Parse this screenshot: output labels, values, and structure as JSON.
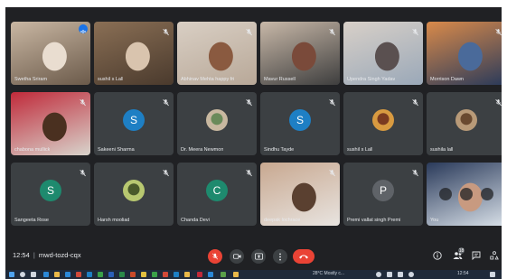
{
  "meeting": {
    "time": "12:54",
    "separator": "|",
    "code": "mwd-tozd-cqx"
  },
  "participants": [
    {
      "name": "Swetha Sriram",
      "type": "video",
      "colors": [
        "#6b5a4a",
        "#c9b7a3",
        "#e9ddd0"
      ]
    },
    {
      "name": "sushil s Lall",
      "type": "video",
      "colors": [
        "#4a3a2d",
        "#8a6f55",
        "#d9c4ae"
      ]
    },
    {
      "name": "Abhinav Mehta happy fri",
      "type": "video",
      "colors": [
        "#b8a898",
        "#d9cfc4",
        "#8a5a40"
      ]
    },
    {
      "name": "Mavur Russell",
      "type": "video",
      "colors": [
        "#3e3e3e",
        "#c8b8a8",
        "#7a4a3a"
      ]
    },
    {
      "name": "Upendra Singh Yadav",
      "type": "video",
      "colors": [
        "#9aa8b8",
        "#d8d0c8",
        "#5a5050"
      ]
    },
    {
      "name": "Morrison Dawn",
      "type": "video",
      "colors": [
        "#2a3a5a",
        "#d98a4a",
        "#4a6a9a"
      ]
    },
    {
      "name": "chabona mullick",
      "type": "video",
      "colors": [
        "#d8d4cc",
        "#c02a3a",
        "#4a3020"
      ]
    },
    {
      "name": "Sakeeni Sharma",
      "type": "initial",
      "initial": "S",
      "color": "#1e7fc4"
    },
    {
      "name": "Dr. Meera Newmon",
      "type": "photo",
      "colors": [
        "#c8b8a0",
        "#6a8a5a"
      ]
    },
    {
      "name": "Sindhu Tayde",
      "type": "initial",
      "initial": "S",
      "color": "#1e7fc4"
    },
    {
      "name": "sushil s Lall",
      "type": "photo",
      "colors": [
        "#d89a40",
        "#7a3a20"
      ]
    },
    {
      "name": "sushila lall",
      "type": "photo",
      "colors": [
        "#b89a78",
        "#6a4a30"
      ]
    },
    {
      "name": "Sangeeta Rose",
      "type": "initial",
      "initial": "S",
      "color": "#1e8a6e"
    },
    {
      "name": "Harsh mooliad",
      "type": "photo",
      "colors": [
        "#b8c870",
        "#4a5a2a"
      ]
    },
    {
      "name": "Chanda Devi",
      "type": "initial",
      "initial": "C",
      "color": "#1e8a6e"
    },
    {
      "name": "deepak lochrace",
      "type": "video",
      "colors": [
        "#e8e4e0",
        "#c8a890",
        "#5a4030"
      ]
    },
    {
      "name": "Premi vallat singh Premi",
      "type": "initial",
      "initial": "P",
      "color": "#5f6368"
    },
    {
      "name": "You",
      "type": "self",
      "colors": [
        "#d8e0e8",
        "#2a3a5a",
        "#c89a80"
      ]
    }
  ],
  "icons": {
    "mic_off": "mic-off-icon",
    "mic_active": "audio-wave-icon",
    "info": "info-icon",
    "people": "people-icon",
    "chat": "chat-icon",
    "activities": "activities-icon",
    "camera": "camera-icon",
    "present": "present-icon",
    "more": "more-options-icon",
    "hangup": "hangup-icon"
  },
  "people_count": "18",
  "colors": {
    "background": "#202124",
    "tile": "#3c4043",
    "hangup": "#ea4335",
    "accent": "#1a73e8"
  },
  "taskbar": {
    "weather": "28°C Mostly c...",
    "time": "12:54"
  }
}
